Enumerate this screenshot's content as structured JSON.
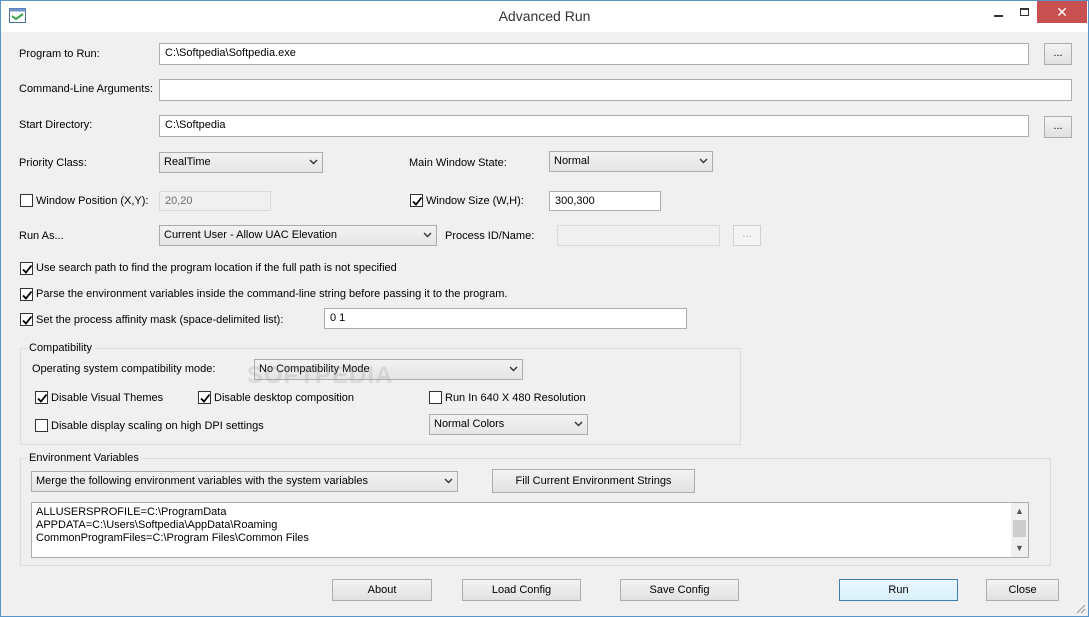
{
  "window": {
    "title": "Advanced Run",
    "close_glyph": "✕"
  },
  "program": {
    "label": "Program to Run:",
    "value": "C:\\Softpedia\\Softpedia.exe",
    "browse": "..."
  },
  "args": {
    "label": "Command-Line Arguments:",
    "value": ""
  },
  "start_dir": {
    "label": "Start Directory:",
    "value": "C:\\Softpedia",
    "browse": "..."
  },
  "priority": {
    "label": "Priority Class:",
    "value": "RealTime"
  },
  "main_window_state": {
    "label": "Main Window State:",
    "value": "Normal"
  },
  "window_position": {
    "label": "Window Position (X,Y):",
    "checked": false,
    "value": "20,20"
  },
  "window_size": {
    "label": "Window Size (W,H):",
    "checked": true,
    "value": "300,300"
  },
  "run_as": {
    "label": "Run As...",
    "value": "Current User - Allow UAC Elevation"
  },
  "process_id": {
    "label": "Process ID/Name:",
    "value": "",
    "browse": "..."
  },
  "options": {
    "search_path": {
      "label": "Use search path to find the program location if the full path is not specified",
      "checked": true
    },
    "parse_env": {
      "label": "Parse the environment variables inside the command-line string before passing it to the program.",
      "checked": true
    },
    "affinity": {
      "label": "Set the process affinity mask (space-delimited list):",
      "checked": true,
      "value": "0 1"
    }
  },
  "compatibility": {
    "title": "Compatibility",
    "os_mode_label": "Operating system compatibility mode:",
    "os_mode_value": "No Compatibility Mode",
    "disable_themes": {
      "label": "Disable Visual Themes",
      "checked": true
    },
    "disable_composition": {
      "label": "Disable desktop composition",
      "checked": true
    },
    "run_640": {
      "label": "Run In 640 X 480 Resolution",
      "checked": false
    },
    "disable_dpi": {
      "label": "Disable display scaling on high DPI settings",
      "checked": false
    },
    "colors_value": "Normal Colors"
  },
  "environment": {
    "title": "Environment Variables",
    "mode_value": "Merge the following environment variables with the system variables",
    "fill_button": "Fill Current Environment Strings",
    "lines": [
      "ALLUSERSPROFILE=C:\\ProgramData",
      "APPDATA=C:\\Users\\Softpedia\\AppData\\Roaming",
      "CommonProgramFiles=C:\\Program Files\\Common Files"
    ]
  },
  "buttons": {
    "about": "About",
    "load": "Load Config",
    "save": "Save Config",
    "run": "Run",
    "close": "Close"
  },
  "watermark": "SOFTPEDIA"
}
